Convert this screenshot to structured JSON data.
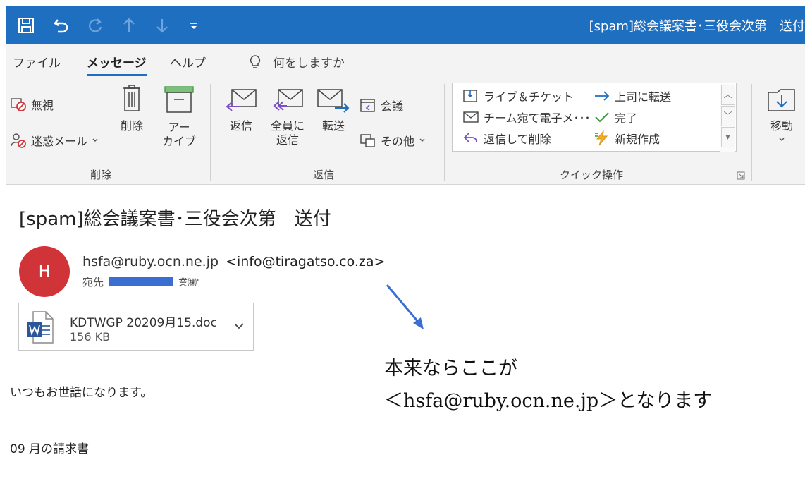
{
  "titlebar": {
    "window_title": "[spam]総会議案書･三役会次第　送付",
    "accent": "#1f6fc0"
  },
  "quick_access": [
    "save-icon",
    "undo-icon",
    "redo-icon",
    "up-icon",
    "down-icon",
    "customize-icon"
  ],
  "menu": {
    "file": "ファイル",
    "message": "メッセージ",
    "help": "ヘルプ",
    "tell_me": "何をしますか"
  },
  "ribbon": {
    "delete_group": {
      "ignore": "無視",
      "junk": "迷惑メール",
      "delete": "削除",
      "archive_1": "アー",
      "archive_2": "カイブ",
      "label": "削除"
    },
    "respond_group": {
      "reply": "返信",
      "reply_all_1": "全員に",
      "reply_all_2": "返信",
      "forward": "転送",
      "meeting": "会議",
      "more": "その他",
      "label": "返信"
    },
    "quick_steps": {
      "items": [
        "ライブ＆チケット",
        "上司に転送",
        "チーム宛て電子メ･･･",
        "完了",
        "返信して削除",
        "新規作成"
      ],
      "label": "クイック操作"
    },
    "move_group": {
      "move": "移動"
    }
  },
  "message": {
    "subject": "[spam]総会議案書･三役会次第　送付",
    "avatar_initial": "H",
    "avatar_color": "#d13438",
    "sender_name": "hsfa@ruby.ocn.ne.jp",
    "sender_address": "<info@tiragatso.co.za>",
    "to_label": "宛先",
    "to_suffix": "業㈱'",
    "attachment": {
      "name": "KDTWGP 20209月15.doc",
      "size": "156 KB"
    },
    "body": [
      "いつもお世話になります。",
      "09 月の請求書"
    ]
  },
  "annotation": {
    "line1": "本来ならここが",
    "line2": "＜hsfa@ruby.ocn.ne.jp＞となります",
    "arrow_color": "#3a6fd1"
  }
}
